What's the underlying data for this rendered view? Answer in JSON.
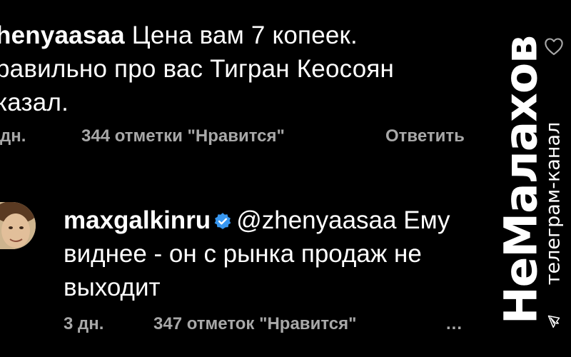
{
  "comment": {
    "username": "henyaasaa",
    "lines": [
      "Цена вам 7 копеек.",
      "равильно про вас Тигран Кеосоян",
      "казал."
    ],
    "time": "дн.",
    "likes": "344 отметки \"Нравится\"",
    "reply_label": "Ответить",
    "like_icon": "heart-outline-icon"
  },
  "reply": {
    "username": "maxgalkinru",
    "verified_icon": "verified-badge-icon",
    "mention": "@zhenyaasaa",
    "text_first": "Ему",
    "lines": [
      "виднее - он с рынка продаж не",
      "выходит"
    ],
    "time": "3 дн.",
    "likes": "347 отметок \"Нравится\"",
    "more_label": "..."
  },
  "watermark": {
    "title": "НеМалахов",
    "subtitle": "телеграм-канал",
    "icon": "telegram-icon"
  },
  "colors": {
    "background": "#000000",
    "text": "#ffffff",
    "meta": "#a8a8a8",
    "verified": "#3897f0"
  }
}
